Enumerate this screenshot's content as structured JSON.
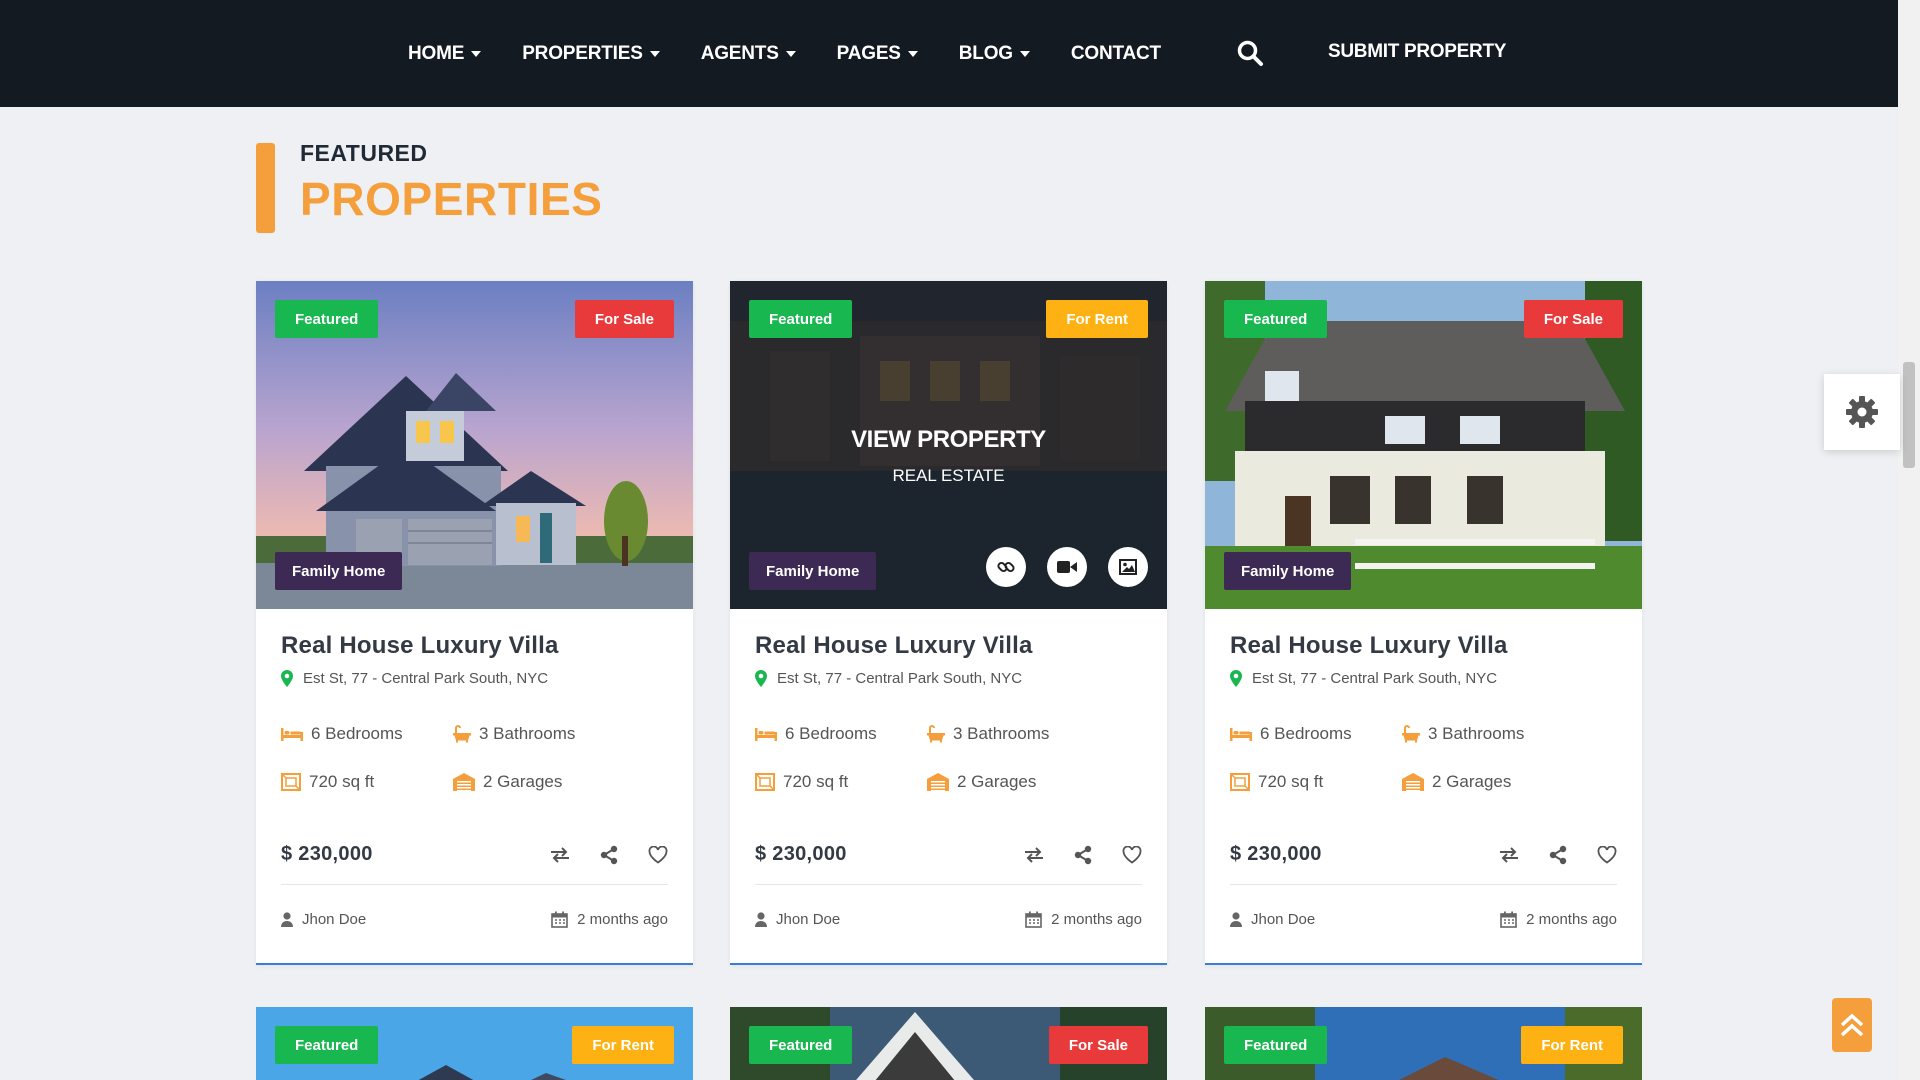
{
  "nav": {
    "items": [
      {
        "label": "HOME",
        "dropdown": true
      },
      {
        "label": "PROPERTIES",
        "dropdown": true
      },
      {
        "label": "AGENTS",
        "dropdown": true
      },
      {
        "label": "PAGES",
        "dropdown": true
      },
      {
        "label": "BLOG",
        "dropdown": true
      },
      {
        "label": "CONTACT",
        "dropdown": false
      }
    ],
    "search_icon": "search-icon",
    "submit_label": "SUBMIT PROPERTY"
  },
  "section": {
    "subtitle": "FEATURED",
    "title": "PROPERTIES"
  },
  "colors": {
    "accent": "#f49f3c",
    "featured": "#18b74f",
    "for_sale": "#e83a3a",
    "for_rent": "#fdb113",
    "type_badge": "#3c2a55",
    "nav_bg": "#141a22"
  },
  "overlay": {
    "title": "VIEW PROPERTY",
    "subtitle": "REAL ESTATE",
    "icons": [
      "link-icon",
      "video-icon",
      "image-icon"
    ]
  },
  "cards": [
    {
      "featured": "Featured",
      "status": "For Sale",
      "type": "Family Home",
      "title": "Real House Luxury Villa",
      "address": "Est St, 77 - Central Park South, NYC",
      "bedrooms": "6 Bedrooms",
      "bathrooms": "3 Bathrooms",
      "area": "720 sq ft",
      "garages": "2 Garages",
      "price": "$ 230,000",
      "agent": "Jhon Doe",
      "date": "2 months ago"
    },
    {
      "featured": "Featured",
      "status": "For Rent",
      "type": "Family Home",
      "title": "Real House Luxury Villa",
      "address": "Est St, 77 - Central Park South, NYC",
      "bedrooms": "6 Bedrooms",
      "bathrooms": "3 Bathrooms",
      "area": "720 sq ft",
      "garages": "2 Garages",
      "price": "$ 230,000",
      "agent": "Jhon Doe",
      "date": "2 months ago"
    },
    {
      "featured": "Featured",
      "status": "For Sale",
      "type": "Family Home",
      "title": "Real House Luxury Villa",
      "address": "Est St, 77 - Central Park South, NYC",
      "bedrooms": "6 Bedrooms",
      "bathrooms": "3 Bathrooms",
      "area": "720 sq ft",
      "garages": "2 Garages",
      "price": "$ 230,000",
      "agent": "Jhon Doe",
      "date": "2 months ago"
    }
  ],
  "next_row": [
    {
      "featured": "Featured",
      "status": "For Rent"
    },
    {
      "featured": "Featured",
      "status": "For Sale"
    },
    {
      "featured": "Featured",
      "status": "For Rent"
    }
  ],
  "widgets": {
    "settings_icon": "gear-icon",
    "back_to_top_icon": "double-chevron-up-icon"
  }
}
